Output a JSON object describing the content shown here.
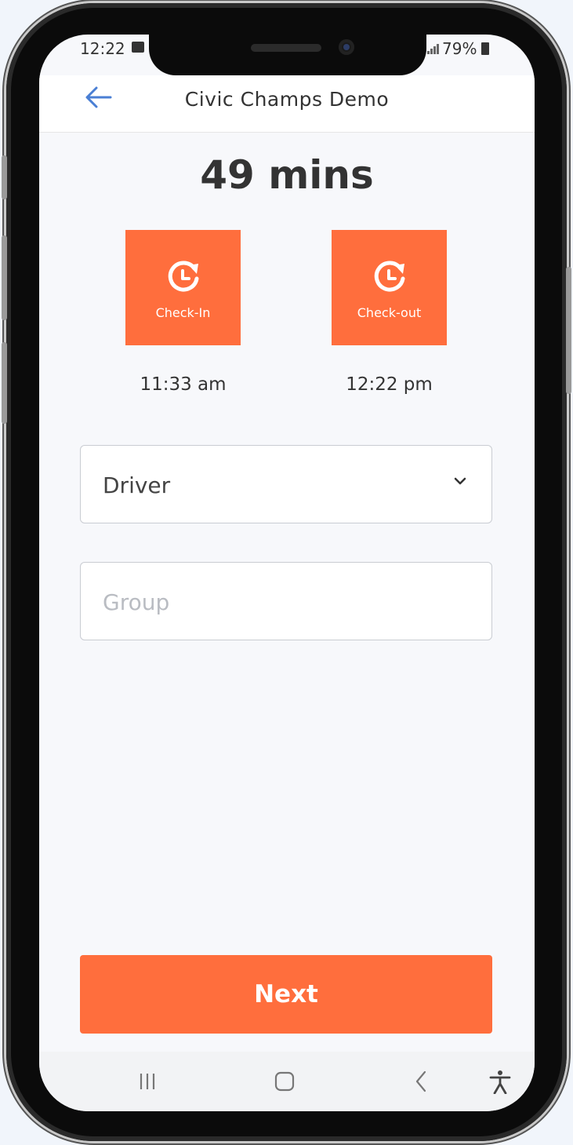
{
  "status_bar": {
    "time": "12:22",
    "battery": "79%"
  },
  "app_bar": {
    "title": "Civic Champs Demo",
    "back_icon": "back-arrow-icon"
  },
  "duration": "49 mins",
  "check_in": {
    "label": "Check-In",
    "time": "11:33 am",
    "icon": "clock-refresh-icon"
  },
  "check_out": {
    "label": "Check-out",
    "time": "12:22 pm",
    "icon": "clock-refresh-icon"
  },
  "role_select": {
    "value": "Driver",
    "icon": "chevron-down-icon"
  },
  "group_input": {
    "placeholder": "Group",
    "value": ""
  },
  "next_button": {
    "label": "Next"
  },
  "nav_bar": {
    "items": [
      "recent-apps-icon",
      "home-icon",
      "back-icon",
      "accessibility-icon"
    ]
  },
  "colors": {
    "accent": "#ff6e3d",
    "back_arrow": "#4a7fd4",
    "text": "#333333",
    "background": "#f7f8fb"
  }
}
